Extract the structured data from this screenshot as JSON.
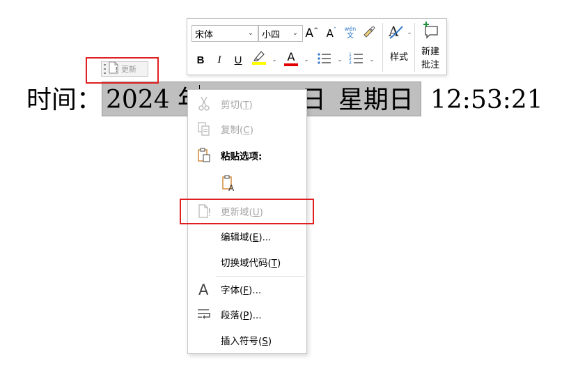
{
  "document": {
    "label": "时间：",
    "field_year": "2024 年",
    "field_day_suffix": "日",
    "field_weekday": "星期日",
    "time": "12:53:21"
  },
  "update_tag": {
    "label": "更新",
    "icon": "document-update-icon"
  },
  "mini_toolbar": {
    "font_name": "宋体",
    "font_size": "小四",
    "grow_font_label": "A",
    "shrink_font_label": "A",
    "phonetic_top": "wén",
    "phonetic_bottom": "文",
    "bold_label": "B",
    "italic_label": "I",
    "underline_label": "U",
    "font_color_label": "A",
    "styles_label": "样式",
    "new_comment_label_line1": "新建",
    "new_comment_label_line2": "批注",
    "colors": {
      "highlight": "#ffff00",
      "font_color": "#e00000",
      "comment_plus": "#1f8f3a"
    }
  },
  "context_menu": {
    "cut": {
      "label": "剪切(",
      "key": "T",
      "tail": ")"
    },
    "copy": {
      "label": "复制(",
      "key": "C",
      "tail": ")"
    },
    "paste_options": {
      "label": "粘贴选项:"
    },
    "update_field": {
      "label": "更新域(",
      "key": "U",
      "tail": ")"
    },
    "edit_field": {
      "label": "编辑域(",
      "key": "E",
      "tail": ")..."
    },
    "toggle_field_codes": {
      "label": "切换域代码(",
      "key": "T",
      "tail": ")"
    },
    "font": {
      "label": "字体(",
      "key": "F",
      "tail": ")..."
    },
    "paragraph": {
      "label": "段落(",
      "key": "P",
      "tail": ")..."
    },
    "insert_symbol": {
      "label": "插入符号(",
      "key": "S",
      "tail": ")"
    }
  },
  "highlight_color": "#e02020"
}
